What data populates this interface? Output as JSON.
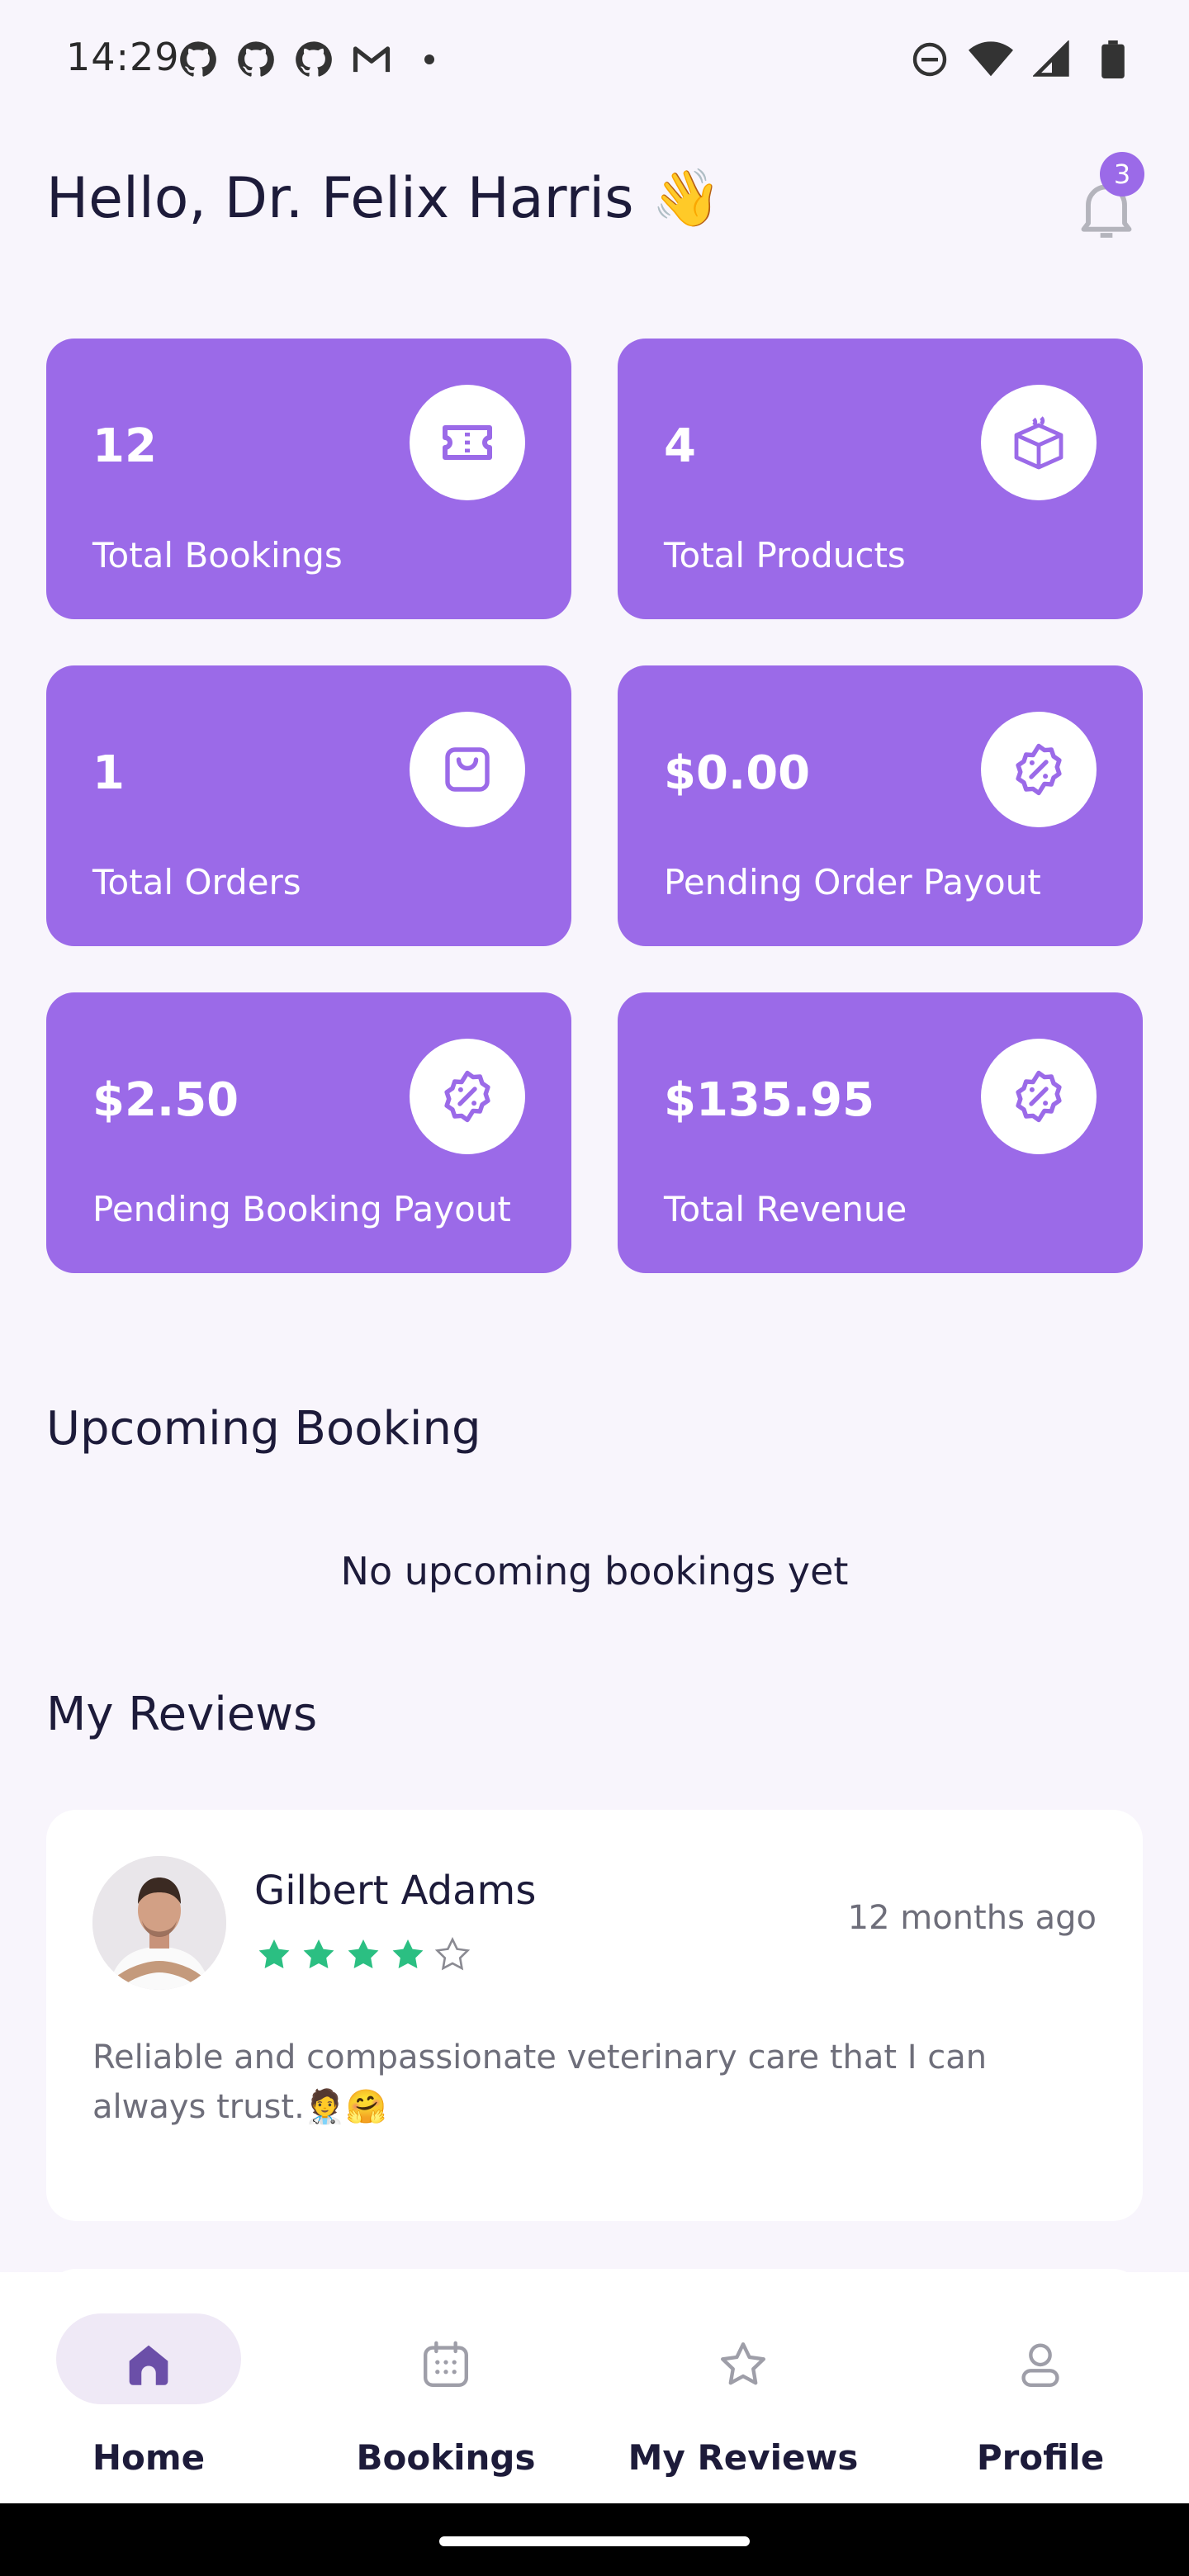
{
  "status_bar": {
    "time": "14:29",
    "left_icons": [
      "github-icon",
      "github-icon",
      "github-icon",
      "gmail-icon"
    ],
    "right_icons": [
      "do-not-disturb-icon",
      "wifi-icon",
      "signal-icon",
      "battery-icon"
    ]
  },
  "header": {
    "greeting": "Hello, Dr. Felix Harris 👋",
    "notification_count": "3"
  },
  "stats": [
    {
      "value": "12",
      "label": "Total Bookings",
      "icon": "ticket-icon"
    },
    {
      "value": "4",
      "label": "Total Products",
      "icon": "box-icon"
    },
    {
      "value": "1",
      "label": "Total Orders",
      "icon": "bag-icon"
    },
    {
      "value": "$0.00",
      "label": "Pending Order Payout",
      "icon": "discount-badge-icon"
    },
    {
      "value": "$2.50",
      "label": "Pending Booking Payout",
      "icon": "discount-badge-icon"
    },
    {
      "value": "$135.95",
      "label": "Total Revenue",
      "icon": "discount-badge-icon"
    }
  ],
  "upcoming": {
    "title": "Upcoming Booking",
    "empty_text": "No upcoming bookings yet"
  },
  "reviews": {
    "title": "My Reviews",
    "items": [
      {
        "name": "Gilbert Adams",
        "time": "12 months ago",
        "rating": 4,
        "max_rating": 5,
        "text": "Reliable and compassionate veterinary care that I can always trust.🧑‍⚕️🤗"
      }
    ]
  },
  "bottom_nav": [
    {
      "label": "Home",
      "icon": "home-icon",
      "active": true
    },
    {
      "label": "Bookings",
      "icon": "calendar-icon",
      "active": false
    },
    {
      "label": "My Reviews",
      "icon": "star-icon",
      "active": false
    },
    {
      "label": "Profile",
      "icon": "person-icon",
      "active": false
    }
  ],
  "colors": {
    "accent": "#9B6AE8",
    "star": "#2BBF82",
    "background": "#F8F5FC"
  }
}
